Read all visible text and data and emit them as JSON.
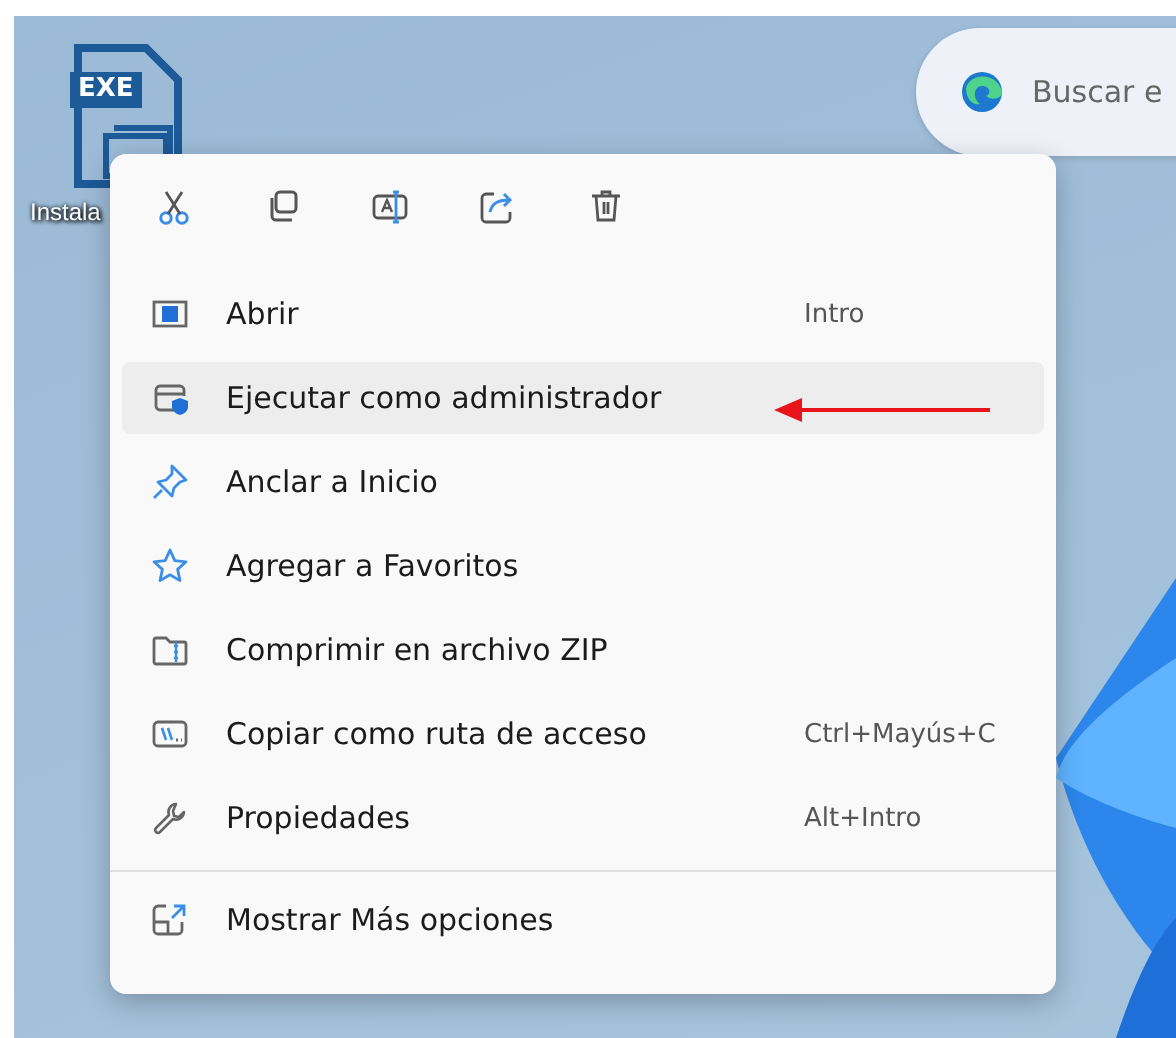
{
  "desktop_icon": {
    "badge": "EXE",
    "label": "Instala"
  },
  "search": {
    "placeholder": "Buscar e"
  },
  "context_menu": {
    "items": [
      {
        "label": "Abrir",
        "shortcut": "Intro",
        "selected": false
      },
      {
        "label": "Ejecutar como administrador",
        "selected": true
      },
      {
        "label": "Anclar a Inicio",
        "selected": false
      },
      {
        "label": "Agregar a Favoritos",
        "selected": false
      },
      {
        "label": "Comprimir en archivo ZIP",
        "selected": false
      },
      {
        "label": "Copiar como ruta de acceso",
        "shortcut": "Ctrl+Mayús+C",
        "selected": false
      },
      {
        "label": "Propiedades",
        "shortcut": "Alt+Intro",
        "selected": false
      }
    ],
    "footer_item": {
      "label": "Mostrar Más opciones"
    }
  }
}
